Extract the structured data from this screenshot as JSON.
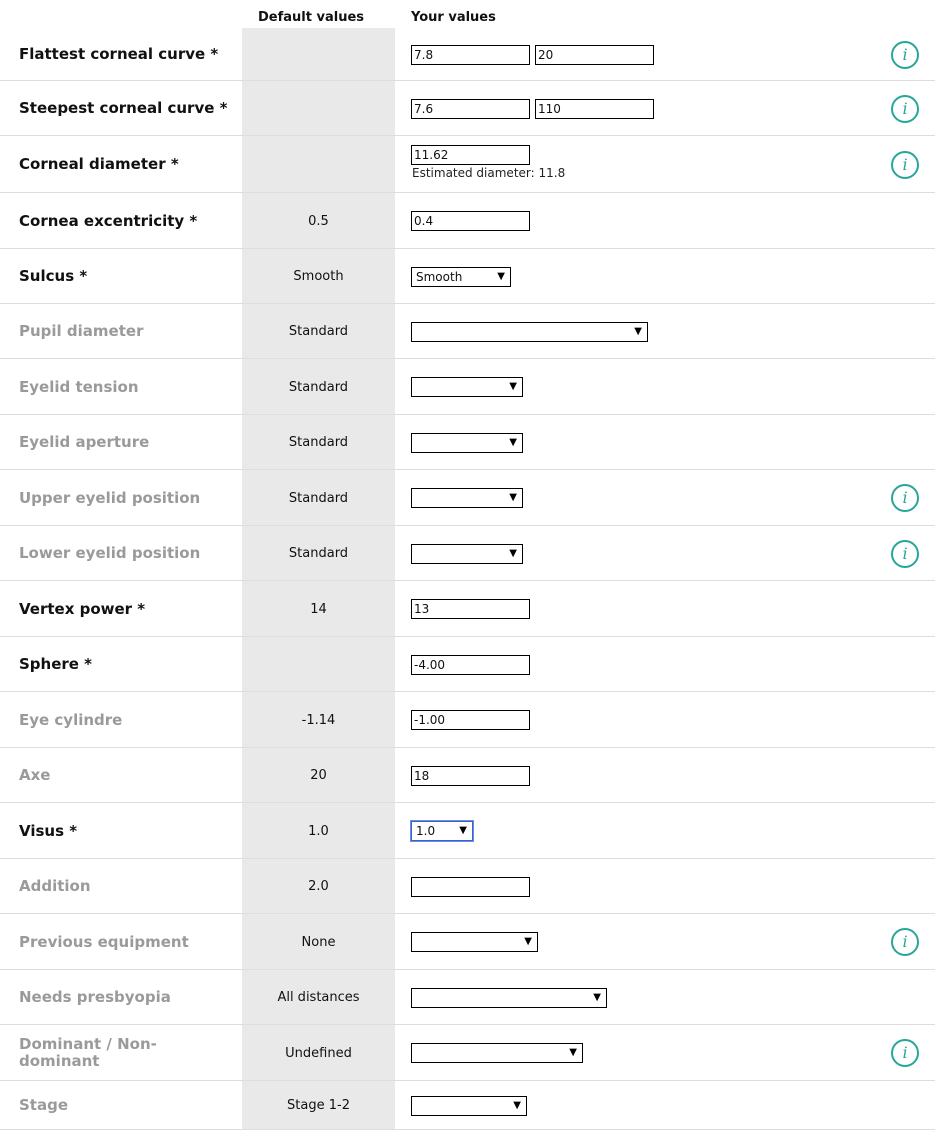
{
  "headers": {
    "default": "Default values",
    "yours": "Your values"
  },
  "rows": [
    {
      "label": "Flattest corneal curve *",
      "default": "",
      "input1": "7.8",
      "input2": "20"
    },
    {
      "label": "Steepest corneal curve *",
      "default": "",
      "input1": "7.6",
      "input2": "110"
    },
    {
      "label": "Corneal diameter *",
      "default": "",
      "input1": "11.62",
      "hint": "Estimated diameter: 11.8"
    },
    {
      "label": "Cornea excentricity *",
      "default": "0.5",
      "input1": "0.4"
    },
    {
      "label": "Sulcus *",
      "default": "Smooth",
      "select": "Smooth"
    },
    {
      "label": "Pupil diameter",
      "default": "Standard",
      "select": ""
    },
    {
      "label": "Eyelid tension",
      "default": "Standard",
      "select": ""
    },
    {
      "label": "Eyelid aperture",
      "default": "Standard",
      "select": ""
    },
    {
      "label": "Upper eyelid position",
      "default": "Standard",
      "select": ""
    },
    {
      "label": "Lower eyelid position",
      "default": "Standard",
      "select": ""
    },
    {
      "label": "Vertex power *",
      "default": "14",
      "input1": "13"
    },
    {
      "label": "Sphere *",
      "default": "",
      "input1": "-4.00"
    },
    {
      "label": "Eye cylindre",
      "default": "-1.14",
      "input1": "-1.00"
    },
    {
      "label": "Axe",
      "default": "20",
      "input1": "18"
    },
    {
      "label": "Visus *",
      "default": "1.0",
      "select": "1.0"
    },
    {
      "label": "Addition",
      "default": "2.0",
      "input1": ""
    },
    {
      "label": "Previous equipment",
      "default": "None",
      "select": ""
    },
    {
      "label": "Needs presbyopia",
      "default": "All distances",
      "select": ""
    },
    {
      "label": "Dominant / Non-dominant",
      "default": "Undefined",
      "select": ""
    },
    {
      "label": "Stage",
      "default": "Stage 1-2",
      "select": ""
    }
  ],
  "icons": {
    "info": "info-icon",
    "dropdown_arrow": "dropdown-arrow-icon"
  },
  "info_glyph": "i",
  "colors": {
    "accent": "#27a69a",
    "required_label": "#111111",
    "optional_label": "#9a9a9a",
    "default_bg": "#e9e9e9"
  }
}
